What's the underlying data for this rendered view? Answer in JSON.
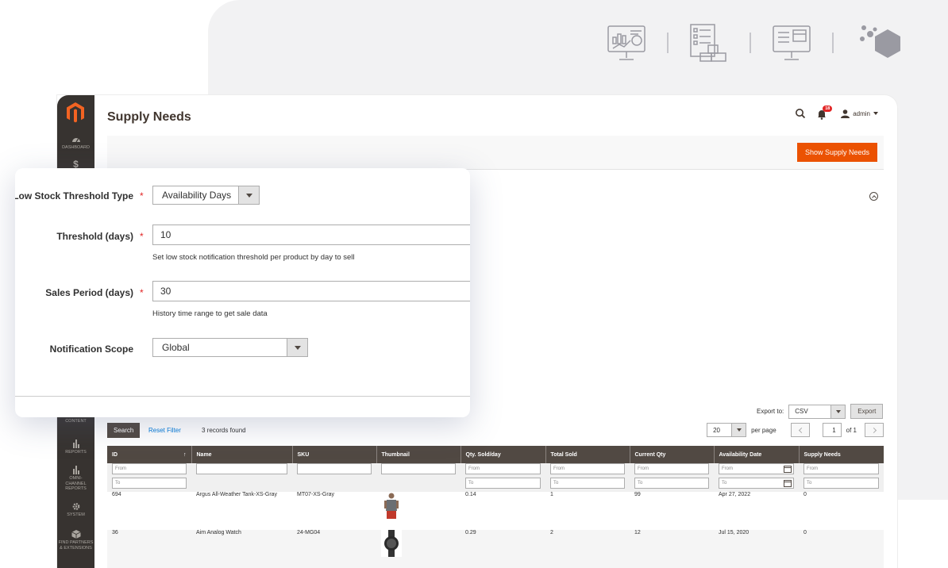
{
  "page": {
    "title": "Supply Needs"
  },
  "header": {
    "notification_count": "18",
    "user": "admin"
  },
  "sidebar": {
    "items": [
      {
        "label": "DASHBOARD",
        "icon": "dashboard-icon"
      },
      {
        "label": "$",
        "icon": "sales-icon"
      },
      {
        "label": "CONTENT",
        "icon": "content-icon"
      },
      {
        "label": "REPORTS",
        "icon": "reports-icon"
      },
      {
        "label": "OMNI-CHANNEL REPORTS",
        "icon": "omni-reports-icon"
      },
      {
        "label": "SYSTEM",
        "icon": "gear-icon"
      },
      {
        "label": "FIND PARTNERS & EXTENSIONS",
        "icon": "box-icon"
      }
    ]
  },
  "actions": {
    "show_supply_needs": "Show Supply Needs"
  },
  "form": {
    "threshold_type": {
      "label": "Low Stock Threshold Type",
      "value": "Availability Days"
    },
    "threshold_days": {
      "label": "Threshold (days)",
      "value": "10",
      "note": "Set low stock notification threshold per product by day to sell"
    },
    "sales_period": {
      "label": "Sales Period (days)",
      "value": "30",
      "note": "History time range to get sale data"
    },
    "scope": {
      "label": "Notification Scope",
      "value": "Global"
    }
  },
  "export": {
    "label": "Export to:",
    "format": "CSV",
    "button": "Export"
  },
  "grid": {
    "search_button": "Search",
    "reset_filter": "Reset Filter",
    "records_found": "3 records found",
    "per_page_value": "20",
    "per_page_label": "per page",
    "current_page": "1",
    "of_pages": "of 1",
    "columns": [
      "ID",
      "Name",
      "SKU",
      "Thumbnail",
      "Qty. Sold/day",
      "Total Sold",
      "Current Qty",
      "Availability Date",
      "Supply Needs"
    ],
    "filter_from": "From",
    "filter_to": "To",
    "rows": [
      {
        "id": "694",
        "name": "Argus All-Weather Tank-XS-Gray",
        "sku": "MT07-XS-Gray",
        "thumbnail": "tank-top-thumbnail",
        "qty_sold_day": "0.14",
        "total_sold": "1",
        "current_qty": "99",
        "availability_date": "Apr 27, 2022",
        "supply_needs": "0"
      },
      {
        "id": "36",
        "name": "Aim Analog Watch",
        "sku": "24-MG04",
        "thumbnail": "watch-thumbnail",
        "qty_sold_day": "0.29",
        "total_sold": "2",
        "current_qty": "12",
        "availability_date": "Jul 15, 2020",
        "supply_needs": "0"
      }
    ]
  }
}
